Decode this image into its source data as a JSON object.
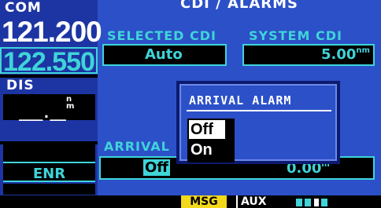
{
  "left_panel": {
    "com_label": "COM",
    "com_active": "121.200",
    "com_standby": "122.550",
    "dis_label": "DIS",
    "dis_value": "___.__",
    "dis_unit_top": "n",
    "dis_unit_bottom": "m",
    "mode": "ENR"
  },
  "page": {
    "title": "CDI / ALARMS",
    "selected_cdi_label": "SELECTED CDI",
    "selected_cdi_value": "Auto",
    "system_cdi_label": "SYSTEM CDI",
    "system_cdi_value": "5.00",
    "system_cdi_unit_top": "n",
    "system_cdi_unit_bottom": "m",
    "arrival_label": "ARRIVAL",
    "arrival_value": "Off",
    "arrival_distance": "0.00",
    "arrival_distance_unit": "m"
  },
  "popup": {
    "title": "ARRIVAL ALARM",
    "options": [
      "Off",
      "On"
    ],
    "selected": "Off"
  },
  "status_bar": {
    "msg_label": "MSG",
    "aux_label": "AUX",
    "page_count": 4,
    "active_page_index": 2
  },
  "colors": {
    "background_blue": "#2c50c8",
    "cyan": "#3fd4d8",
    "msg_yellow": "#f3d81c"
  }
}
